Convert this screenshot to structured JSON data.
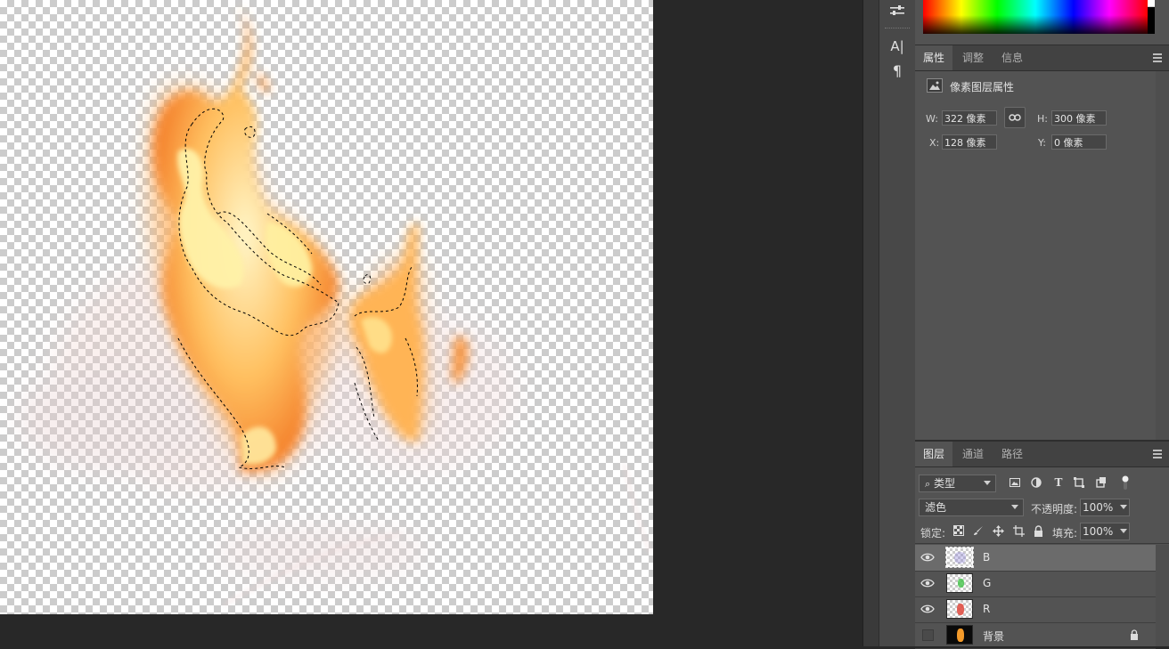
{
  "toolbar_icons": [
    {
      "name": "adjust-sliders-icon",
      "glyph": "⚟"
    },
    {
      "name": "character-icon",
      "glyph": "A|"
    },
    {
      "name": "paragraph-icon",
      "glyph": "¶"
    }
  ],
  "properties_panel": {
    "tabs": [
      "属性",
      "调整",
      "信息"
    ],
    "active_tab": "属性",
    "heading": "像素图层属性",
    "w_label": "W:",
    "w_value": "322 像素",
    "h_label": "H:",
    "h_value": "300 像素",
    "x_label": "X:",
    "x_value": "128 像素",
    "y_label": "Y:",
    "y_value": "0 像素"
  },
  "layers_panel": {
    "tabs": [
      "图层",
      "通道",
      "路径"
    ],
    "active_tab": "图层",
    "filter_kind": "类型",
    "blend_mode": "滤色",
    "opacity_label": "不透明度:",
    "opacity_value": "100%",
    "lock_label": "锁定:",
    "fill_label": "填充:",
    "fill_value": "100%",
    "layers": [
      {
        "name": "B",
        "visible": true,
        "selected": true,
        "tint": "#8a7fd8"
      },
      {
        "name": "G",
        "visible": true,
        "selected": false,
        "tint": "#44c44a"
      },
      {
        "name": "R",
        "visible": true,
        "selected": false,
        "tint": "#e0483c"
      },
      {
        "name": "背景",
        "visible": false,
        "selected": false,
        "locked": true,
        "tint": "#f39a2a"
      }
    ]
  },
  "colors": {
    "flame_core": "#fff3b0",
    "flame_mid": "#ffb347",
    "flame_edge": "#f07a2a"
  }
}
